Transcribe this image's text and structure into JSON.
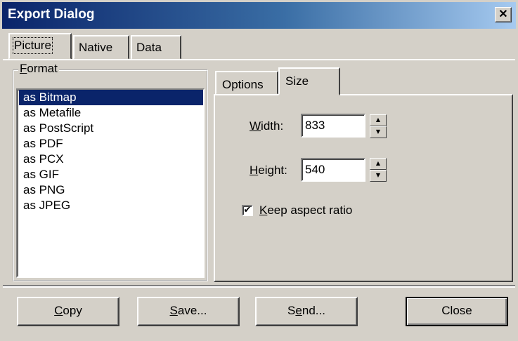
{
  "window": {
    "title": "Export Dialog",
    "close_glyph": "✕"
  },
  "tabs": [
    {
      "label": "Picture",
      "selected": true
    },
    {
      "label": "Native",
      "selected": false
    },
    {
      "label": "Data",
      "selected": false
    }
  ],
  "format_group": {
    "label_prefix": "F",
    "label_rest": "ormat",
    "items": [
      "as Bitmap",
      "as Metafile",
      "as PostScript",
      "as PDF",
      "as PCX",
      "as GIF",
      "as PNG",
      "as JPEG"
    ],
    "selected_index": 0
  },
  "inner_tabs": [
    {
      "label": "Options",
      "selected": false
    },
    {
      "label": "Size",
      "selected": true
    }
  ],
  "size_panel": {
    "width_label_accel": "W",
    "width_label_rest": "idth:",
    "width_value": "833",
    "height_label_accel": "H",
    "height_label_rest": "eight:",
    "height_value": "540",
    "keep_aspect": {
      "accel": "K",
      "rest": "eep aspect ratio",
      "checked": true,
      "check_glyph": "✔"
    }
  },
  "buttons": {
    "copy": {
      "accel": "C",
      "rest": "opy"
    },
    "save": {
      "accel": "S",
      "rest": "ave..."
    },
    "send_prefix": "S",
    "send_accel": "e",
    "send_rest": "nd...",
    "close": "Close"
  },
  "spinner": {
    "up_glyph": "▲",
    "down_glyph": "▼"
  }
}
